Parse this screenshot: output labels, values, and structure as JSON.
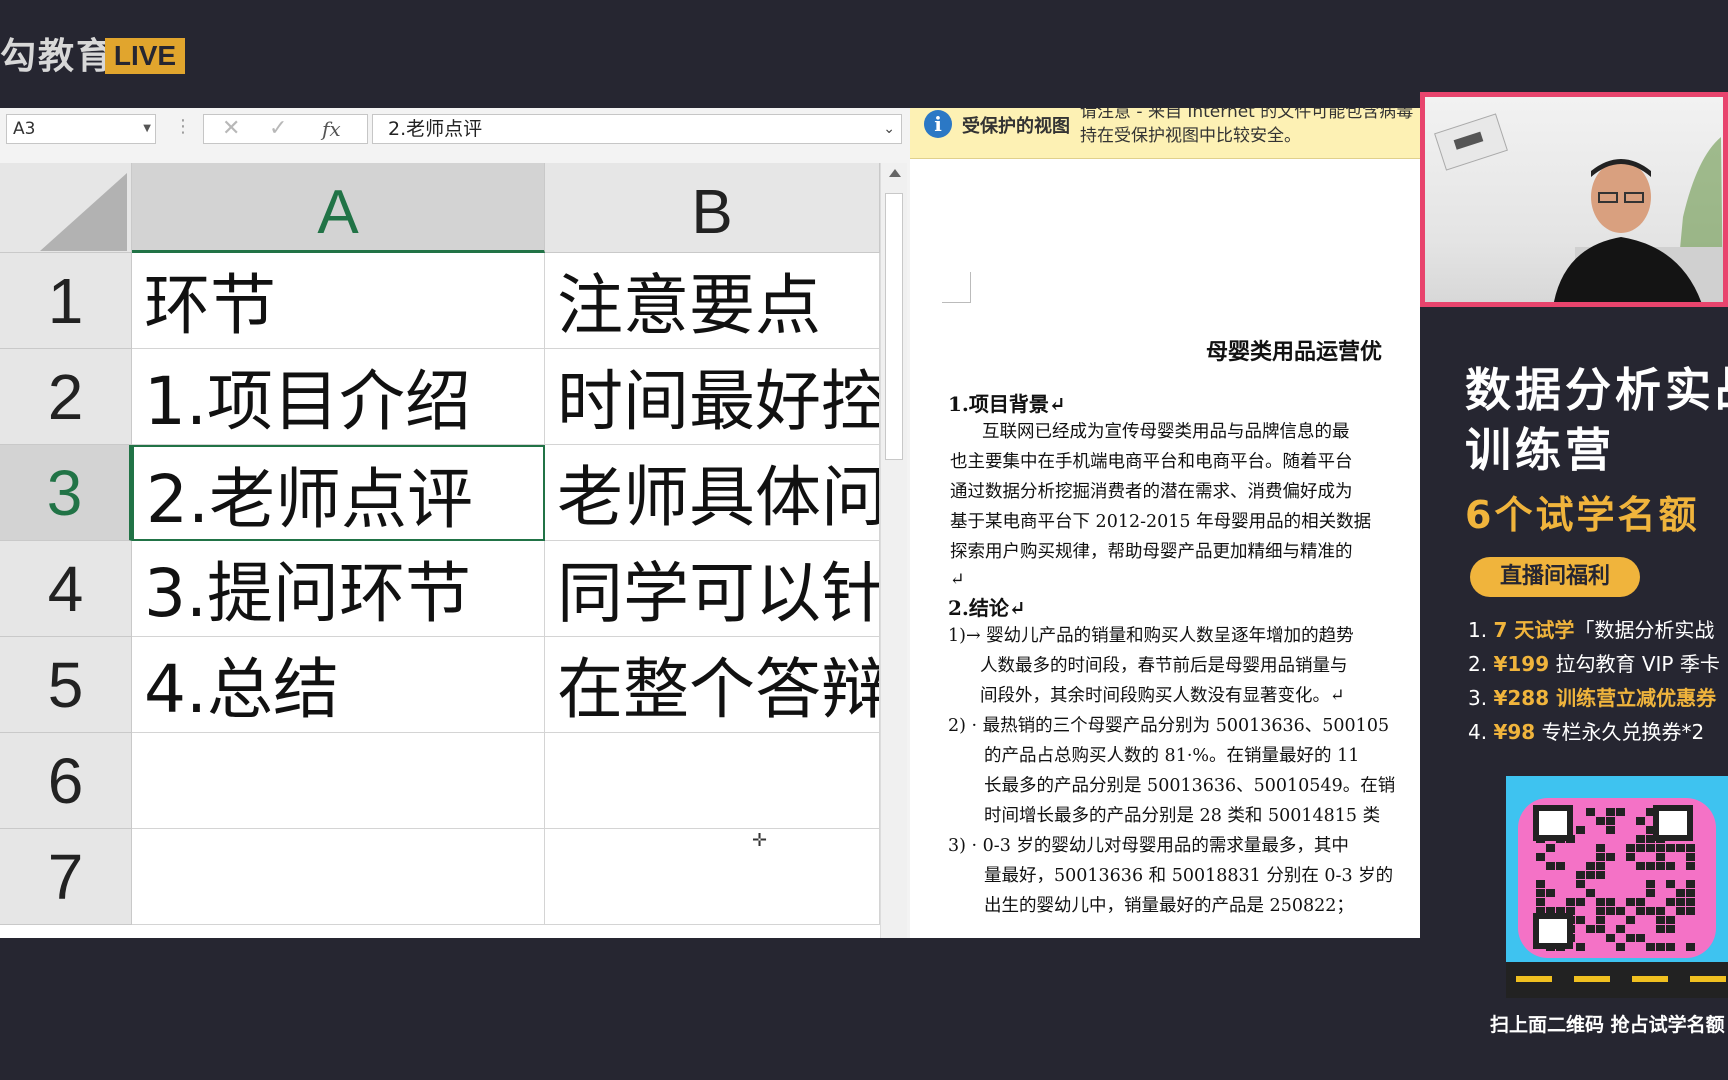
{
  "logo": {
    "text": "勾教育",
    "badge": "LIVE"
  },
  "excel": {
    "name_box": "A3",
    "formula_icons": {
      "cancel": "✕",
      "enter": "✓",
      "fx": "fx"
    },
    "formula_value": "2.老师点评",
    "columns": [
      "A",
      "B"
    ],
    "selected_column": "A",
    "selected_row": "3",
    "rows": [
      {
        "num": "1",
        "a": "环节",
        "b": "注意要点"
      },
      {
        "num": "2",
        "a": "1.项目介绍",
        "b": "时间最好控"
      },
      {
        "num": "3",
        "a": "2.老师点评",
        "b": "老师具体问"
      },
      {
        "num": "4",
        "a": "3.提问环节",
        "b": "同学可以针"
      },
      {
        "num": "5",
        "a": "4.总结",
        "b": "在整个答辩"
      },
      {
        "num": "6",
        "a": "",
        "b": ""
      },
      {
        "num": "7",
        "a": "",
        "b": ""
      }
    ]
  },
  "word": {
    "protected_view": {
      "title": "受保护的视图",
      "line1": "请注意 - 来自 Internet 的文件可能包含病毒",
      "line2": "持在受保护视图中比较安全。"
    },
    "doc_title": "母婴类用品运营优",
    "lines": [
      "1.项目背景↵",
      "互联网已经成为宣传母婴类用品与品牌信息的最",
      "也主要集中在手机端电商平台和电商平台。随着平台",
      "通过数据分析挖掘消费者的潜在需求、消费偏好成为",
      "基于某电商平台下 2012-2015 年母婴用品的相关数据",
      "探索用户购买规律，帮助母婴产品更加精细与精准的",
      "↵",
      "2.结论↵",
      "1)→ 婴幼儿产品的销量和购买人数呈逐年增加的趋势",
      "人数最多的时间段，春节前后是母婴用品销量与",
      "间段外，其余时间段购买人数没有显著变化。↵",
      "2) · 最热销的三个母婴产品分别为 50013636、500105",
      "的产品占总购买人数的 81·%。在销量最好的 11",
      "长最多的产品分别是 50013636、50010549。在销",
      "时间增长最多的产品分别是 28 类和 50014815 类",
      "3) · 0-3 岁的婴幼儿对母婴用品的需求量最多，其中",
      "量最好，50013636 和 50018831 分别在 0-3 岁的",
      "出生的婴幼儿中，销量最好的产品是 250822；"
    ]
  },
  "promo": {
    "title_line1": "数据分析实战",
    "title_line2": "训练营",
    "subtitle": "6个试学名额",
    "benefit_pill": "直播间福利",
    "benefits": [
      {
        "num": "1. ",
        "hl": "7 天试学",
        "rest": "「数据分析实战"
      },
      {
        "num": "2. ",
        "hl": "¥199",
        "rest": " 拉勾教育 VIP 季卡"
      },
      {
        "num": "3. ",
        "hl": "¥288 训练营立减优惠券",
        "rest": ""
      },
      {
        "num": "4. ",
        "hl": "¥98",
        "rest": " 专栏永久兑换券*2"
      }
    ],
    "qr_caption": "扫上面二维码  抢占试学名额"
  },
  "colors": {
    "excel_green": "#217346",
    "promo_gold": "#f0b43c",
    "webcam_border": "#e8446d",
    "background": "#262631"
  }
}
